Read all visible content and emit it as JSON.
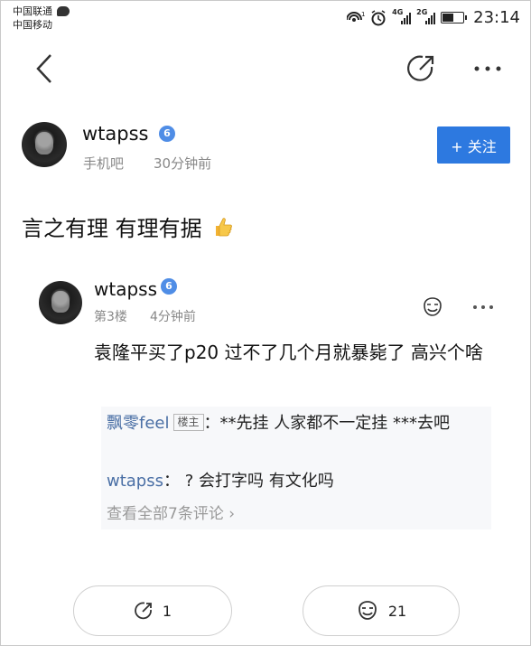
{
  "status_bar": {
    "carrier1": "中国联通",
    "carrier2": "中国移动",
    "sig1_label": "4G",
    "sig2_label": "2G",
    "time": "23:14"
  },
  "post": {
    "author": "wtapss",
    "badge": "6",
    "source": "手机吧",
    "time": "30分钟前",
    "follow_label": "+ 关注",
    "text": "言之有理 有理有据"
  },
  "reply": {
    "author": "wtapss",
    "badge": "6",
    "floor": "第3楼",
    "time": "4分钟前",
    "text": "袁隆平买了p20 过不了几个月就暴毙了 高兴个啥",
    "sub_comments": [
      {
        "author": "飘零feel",
        "tag": "楼主",
        "text": "**先挂 人家都不一定挂 ***去吧"
      },
      {
        "author": "wtapss",
        "text": "? 会打字吗 有文化吗"
      }
    ],
    "view_all": "查看全部7条评论"
  },
  "bottom": {
    "share_count": "1",
    "like_count": "21"
  }
}
